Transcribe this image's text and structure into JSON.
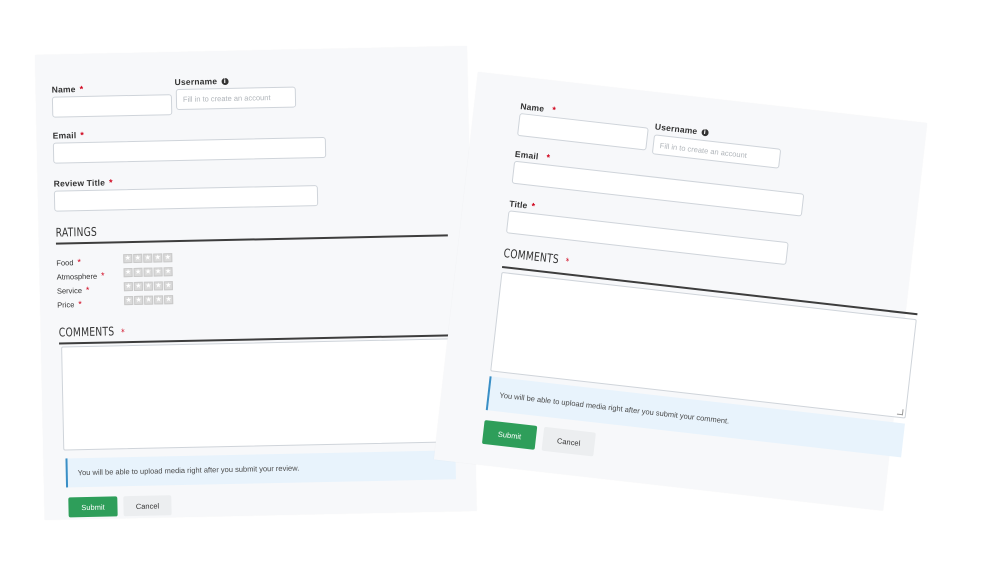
{
  "left_form": {
    "name_label": "Name",
    "username_label": "Username",
    "username_placeholder": "Fill in to create an account",
    "email_label": "Email",
    "review_title_label": "Review Title",
    "required_mark": "*",
    "ratings_heading": "RATINGS",
    "ratings": [
      {
        "label": "Food",
        "stars": 0,
        "max": 5
      },
      {
        "label": "Atmosphere",
        "stars": 0,
        "max": 5
      },
      {
        "label": "Service",
        "stars": 0,
        "max": 5
      },
      {
        "label": "Price",
        "stars": 0,
        "max": 5
      }
    ],
    "comments_heading": "COMMENTS",
    "notice": "You will be able to upload media right after you submit your review.",
    "submit_label": "Submit",
    "cancel_label": "Cancel"
  },
  "right_form": {
    "name_label": "Name",
    "username_label": "Username",
    "username_placeholder": "Fill in to create an account",
    "email_label": "Email",
    "title_label": "Title",
    "required_mark": "*",
    "comments_heading": "COMMENTS",
    "notice": "You will be able to upload media right after you submit your comment.",
    "submit_label": "Submit",
    "cancel_label": "Cancel"
  },
  "colors": {
    "accent_green": "#2e9e5a",
    "required_red": "#d0021b",
    "notice_bg": "#e8f3fc",
    "notice_border": "#3a8fc6"
  },
  "icons": {
    "info": "info-icon",
    "star": "star-icon"
  }
}
